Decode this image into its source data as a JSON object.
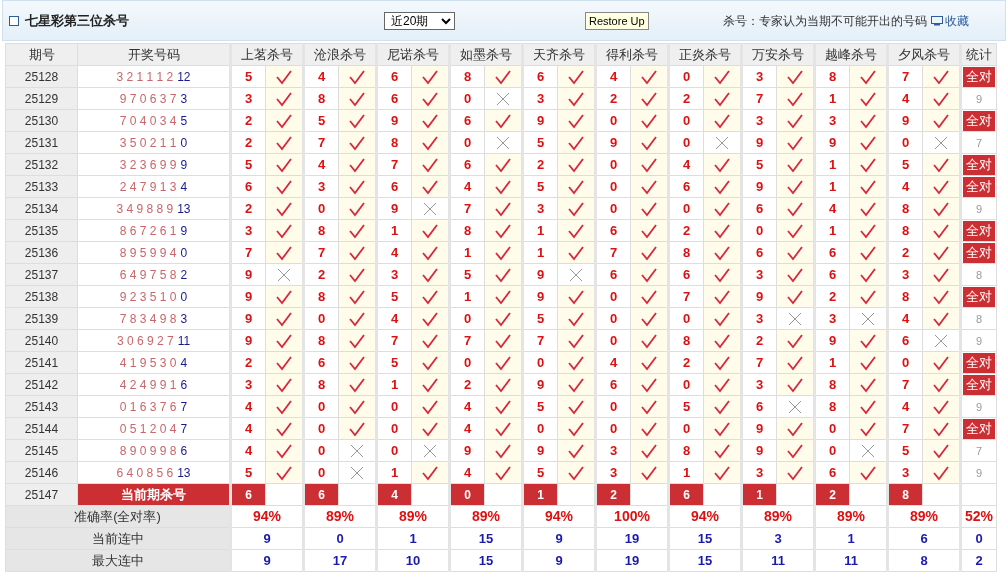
{
  "header": {
    "title": "七星彩第三位杀号",
    "period_select": "近20期",
    "restore_button": "Restore Up",
    "note": "杀号：专家认为当期不可能开出的号码",
    "favorite": "收藏"
  },
  "table": {
    "columns": [
      "期号",
      "开奖号码",
      "上茗杀号",
      "沧浪杀号",
      "尼诺杀号",
      "如墨杀号",
      "天齐杀号",
      "得利杀号",
      "正炎杀号",
      "万安杀号",
      "越峰杀号",
      "夕风杀号",
      "统计"
    ],
    "rows": [
      {
        "period": "25128",
        "front": "3 2 1 1 1 2",
        "back": "12",
        "picks": [
          {
            "number": "5",
            "hit": true
          },
          {
            "number": "4",
            "hit": true
          },
          {
            "number": "6",
            "hit": true
          },
          {
            "number": "8",
            "hit": true
          },
          {
            "number": "6",
            "hit": true
          },
          {
            "number": "4",
            "hit": true
          },
          {
            "number": "0",
            "hit": true
          },
          {
            "number": "3",
            "hit": true
          },
          {
            "number": "8",
            "hit": true
          },
          {
            "number": "7",
            "hit": true
          }
        ],
        "stat": {
          "text": "全对",
          "all_correct": true
        }
      },
      {
        "period": "25129",
        "front": "9 7 0 6 3 7",
        "back": "3",
        "picks": [
          {
            "number": "3",
            "hit": true
          },
          {
            "number": "8",
            "hit": true
          },
          {
            "number": "6",
            "hit": true
          },
          {
            "number": "0",
            "hit": false
          },
          {
            "number": "3",
            "hit": true
          },
          {
            "number": "2",
            "hit": true
          },
          {
            "number": "2",
            "hit": true
          },
          {
            "number": "7",
            "hit": true
          },
          {
            "number": "1",
            "hit": true
          },
          {
            "number": "4",
            "hit": true
          }
        ],
        "stat": {
          "text": "9",
          "all_correct": false
        }
      },
      {
        "period": "25130",
        "front": "7 0 4 0 3 4",
        "back": "5",
        "picks": [
          {
            "number": "2",
            "hit": true
          },
          {
            "number": "5",
            "hit": true
          },
          {
            "number": "9",
            "hit": true
          },
          {
            "number": "6",
            "hit": true
          },
          {
            "number": "9",
            "hit": true
          },
          {
            "number": "0",
            "hit": true
          },
          {
            "number": "0",
            "hit": true
          },
          {
            "number": "3",
            "hit": true
          },
          {
            "number": "3",
            "hit": true
          },
          {
            "number": "9",
            "hit": true
          }
        ],
        "stat": {
          "text": "全对",
          "all_correct": true
        }
      },
      {
        "period": "25131",
        "front": "3 5 0 2 1 1",
        "back": "0",
        "picks": [
          {
            "number": "2",
            "hit": true
          },
          {
            "number": "7",
            "hit": true
          },
          {
            "number": "8",
            "hit": true
          },
          {
            "number": "0",
            "hit": false
          },
          {
            "number": "5",
            "hit": true
          },
          {
            "number": "9",
            "hit": true
          },
          {
            "number": "0",
            "hit": false
          },
          {
            "number": "9",
            "hit": true
          },
          {
            "number": "9",
            "hit": true
          },
          {
            "number": "0",
            "hit": false
          }
        ],
        "stat": {
          "text": "7",
          "all_correct": false
        }
      },
      {
        "period": "25132",
        "front": "3 2 3 6 9 9",
        "back": "9",
        "picks": [
          {
            "number": "5",
            "hit": true
          },
          {
            "number": "4",
            "hit": true
          },
          {
            "number": "7",
            "hit": true
          },
          {
            "number": "6",
            "hit": true
          },
          {
            "number": "2",
            "hit": true
          },
          {
            "number": "0",
            "hit": true
          },
          {
            "number": "4",
            "hit": true
          },
          {
            "number": "5",
            "hit": true
          },
          {
            "number": "1",
            "hit": true
          },
          {
            "number": "5",
            "hit": true
          }
        ],
        "stat": {
          "text": "全对",
          "all_correct": true
        }
      },
      {
        "period": "25133",
        "front": "2 4 7 9 1 3",
        "back": "4",
        "picks": [
          {
            "number": "6",
            "hit": true
          },
          {
            "number": "3",
            "hit": true
          },
          {
            "number": "6",
            "hit": true
          },
          {
            "number": "4",
            "hit": true
          },
          {
            "number": "5",
            "hit": true
          },
          {
            "number": "0",
            "hit": true
          },
          {
            "number": "6",
            "hit": true
          },
          {
            "number": "9",
            "hit": true
          },
          {
            "number": "1",
            "hit": true
          },
          {
            "number": "4",
            "hit": true
          }
        ],
        "stat": {
          "text": "全对",
          "all_correct": true
        }
      },
      {
        "period": "25134",
        "front": "3 4 9 8 8 9",
        "back": "13",
        "picks": [
          {
            "number": "2",
            "hit": true
          },
          {
            "number": "0",
            "hit": true
          },
          {
            "number": "9",
            "hit": false
          },
          {
            "number": "7",
            "hit": true
          },
          {
            "number": "3",
            "hit": true
          },
          {
            "number": "0",
            "hit": true
          },
          {
            "number": "0",
            "hit": true
          },
          {
            "number": "6",
            "hit": true
          },
          {
            "number": "4",
            "hit": true
          },
          {
            "number": "8",
            "hit": true
          }
        ],
        "stat": {
          "text": "9",
          "all_correct": false
        }
      },
      {
        "period": "25135",
        "front": "8 6 7 2 6 1",
        "back": "9",
        "picks": [
          {
            "number": "3",
            "hit": true
          },
          {
            "number": "8",
            "hit": true
          },
          {
            "number": "1",
            "hit": true
          },
          {
            "number": "8",
            "hit": true
          },
          {
            "number": "1",
            "hit": true
          },
          {
            "number": "6",
            "hit": true
          },
          {
            "number": "2",
            "hit": true
          },
          {
            "number": "0",
            "hit": true
          },
          {
            "number": "1",
            "hit": true
          },
          {
            "number": "8",
            "hit": true
          }
        ],
        "stat": {
          "text": "全对",
          "all_correct": true
        }
      },
      {
        "period": "25136",
        "front": "8 9 5 9 9 4",
        "back": "0",
        "picks": [
          {
            "number": "7",
            "hit": true
          },
          {
            "number": "7",
            "hit": true
          },
          {
            "number": "4",
            "hit": true
          },
          {
            "number": "1",
            "hit": true
          },
          {
            "number": "1",
            "hit": true
          },
          {
            "number": "7",
            "hit": true
          },
          {
            "number": "8",
            "hit": true
          },
          {
            "number": "6",
            "hit": true
          },
          {
            "number": "6",
            "hit": true
          },
          {
            "number": "2",
            "hit": true
          }
        ],
        "stat": {
          "text": "全对",
          "all_correct": true
        }
      },
      {
        "period": "25137",
        "front": "6 4 9 7 5 8",
        "back": "2",
        "picks": [
          {
            "number": "9",
            "hit": false
          },
          {
            "number": "2",
            "hit": true
          },
          {
            "number": "3",
            "hit": true
          },
          {
            "number": "5",
            "hit": true
          },
          {
            "number": "9",
            "hit": false
          },
          {
            "number": "6",
            "hit": true
          },
          {
            "number": "6",
            "hit": true
          },
          {
            "number": "3",
            "hit": true
          },
          {
            "number": "6",
            "hit": true
          },
          {
            "number": "3",
            "hit": true
          }
        ],
        "stat": {
          "text": "8",
          "all_correct": false
        }
      },
      {
        "period": "25138",
        "front": "9 2 3 5 1 0",
        "back": "0",
        "picks": [
          {
            "number": "9",
            "hit": true
          },
          {
            "number": "8",
            "hit": true
          },
          {
            "number": "5",
            "hit": true
          },
          {
            "number": "1",
            "hit": true
          },
          {
            "number": "9",
            "hit": true
          },
          {
            "number": "0",
            "hit": true
          },
          {
            "number": "7",
            "hit": true
          },
          {
            "number": "9",
            "hit": true
          },
          {
            "number": "2",
            "hit": true
          },
          {
            "number": "8",
            "hit": true
          }
        ],
        "stat": {
          "text": "全对",
          "all_correct": true
        }
      },
      {
        "period": "25139",
        "front": "7 8 3 4 9 8",
        "back": "3",
        "picks": [
          {
            "number": "9",
            "hit": true
          },
          {
            "number": "0",
            "hit": true
          },
          {
            "number": "4",
            "hit": true
          },
          {
            "number": "0",
            "hit": true
          },
          {
            "number": "5",
            "hit": true
          },
          {
            "number": "0",
            "hit": true
          },
          {
            "number": "0",
            "hit": true
          },
          {
            "number": "3",
            "hit": false
          },
          {
            "number": "3",
            "hit": false
          },
          {
            "number": "4",
            "hit": true
          }
        ],
        "stat": {
          "text": "8",
          "all_correct": false
        }
      },
      {
        "period": "25140",
        "front": "3 0 6 9 2 7",
        "back": "11",
        "picks": [
          {
            "number": "9",
            "hit": true
          },
          {
            "number": "8",
            "hit": true
          },
          {
            "number": "7",
            "hit": true
          },
          {
            "number": "7",
            "hit": true
          },
          {
            "number": "7",
            "hit": true
          },
          {
            "number": "0",
            "hit": true
          },
          {
            "number": "8",
            "hit": true
          },
          {
            "number": "2",
            "hit": true
          },
          {
            "number": "9",
            "hit": true
          },
          {
            "number": "6",
            "hit": false
          }
        ],
        "stat": {
          "text": "9",
          "all_correct": false
        }
      },
      {
        "period": "25141",
        "front": "4 1 9 5 3 0",
        "back": "4",
        "picks": [
          {
            "number": "2",
            "hit": true
          },
          {
            "number": "6",
            "hit": true
          },
          {
            "number": "5",
            "hit": true
          },
          {
            "number": "0",
            "hit": true
          },
          {
            "number": "0",
            "hit": true
          },
          {
            "number": "4",
            "hit": true
          },
          {
            "number": "2",
            "hit": true
          },
          {
            "number": "7",
            "hit": true
          },
          {
            "number": "1",
            "hit": true
          },
          {
            "number": "0",
            "hit": true
          }
        ],
        "stat": {
          "text": "全对",
          "all_correct": true
        }
      },
      {
        "period": "25142",
        "front": "4 2 4 9 9 1",
        "back": "6",
        "picks": [
          {
            "number": "3",
            "hit": true
          },
          {
            "number": "8",
            "hit": true
          },
          {
            "number": "1",
            "hit": true
          },
          {
            "number": "2",
            "hit": true
          },
          {
            "number": "9",
            "hit": true
          },
          {
            "number": "6",
            "hit": true
          },
          {
            "number": "0",
            "hit": true
          },
          {
            "number": "3",
            "hit": true
          },
          {
            "number": "8",
            "hit": true
          },
          {
            "number": "7",
            "hit": true
          }
        ],
        "stat": {
          "text": "全对",
          "all_correct": true
        }
      },
      {
        "period": "25143",
        "front": "0 1 6 3 7 6",
        "back": "7",
        "picks": [
          {
            "number": "4",
            "hit": true
          },
          {
            "number": "0",
            "hit": true
          },
          {
            "number": "0",
            "hit": true
          },
          {
            "number": "4",
            "hit": true
          },
          {
            "number": "5",
            "hit": true
          },
          {
            "number": "0",
            "hit": true
          },
          {
            "number": "5",
            "hit": true
          },
          {
            "number": "6",
            "hit": false
          },
          {
            "number": "8",
            "hit": true
          },
          {
            "number": "4",
            "hit": true
          }
        ],
        "stat": {
          "text": "9",
          "all_correct": false
        }
      },
      {
        "period": "25144",
        "front": "0 5 1 2 0 4",
        "back": "7",
        "picks": [
          {
            "number": "4",
            "hit": true
          },
          {
            "number": "0",
            "hit": true
          },
          {
            "number": "0",
            "hit": true
          },
          {
            "number": "4",
            "hit": true
          },
          {
            "number": "0",
            "hit": true
          },
          {
            "number": "0",
            "hit": true
          },
          {
            "number": "0",
            "hit": true
          },
          {
            "number": "9",
            "hit": true
          },
          {
            "number": "0",
            "hit": true
          },
          {
            "number": "7",
            "hit": true
          }
        ],
        "stat": {
          "text": "全对",
          "all_correct": true
        }
      },
      {
        "period": "25145",
        "front": "8 9 0 9 9 8",
        "back": "6",
        "picks": [
          {
            "number": "4",
            "hit": true
          },
          {
            "number": "0",
            "hit": false
          },
          {
            "number": "0",
            "hit": false
          },
          {
            "number": "9",
            "hit": true
          },
          {
            "number": "9",
            "hit": true
          },
          {
            "number": "3",
            "hit": true
          },
          {
            "number": "8",
            "hit": true
          },
          {
            "number": "9",
            "hit": true
          },
          {
            "number": "0",
            "hit": false
          },
          {
            "number": "5",
            "hit": true
          }
        ],
        "stat": {
          "text": "7",
          "all_correct": false
        }
      },
      {
        "period": "25146",
        "front": "6 4 0 8 5 6",
        "back": "13",
        "picks": [
          {
            "number": "5",
            "hit": true
          },
          {
            "number": "0",
            "hit": false
          },
          {
            "number": "1",
            "hit": true
          },
          {
            "number": "4",
            "hit": true
          },
          {
            "number": "5",
            "hit": true
          },
          {
            "number": "3",
            "hit": true
          },
          {
            "number": "1",
            "hit": true
          },
          {
            "number": "3",
            "hit": true
          },
          {
            "number": "6",
            "hit": true
          },
          {
            "number": "3",
            "hit": true
          }
        ],
        "stat": {
          "text": "9",
          "all_correct": false
        }
      }
    ],
    "current": {
      "period": "25147",
      "label": "当前期杀号",
      "picks": [
        "6",
        "6",
        "4",
        "0",
        "1",
        "2",
        "6",
        "1",
        "2",
        "8"
      ]
    },
    "summary": [
      {
        "label": "准确率(全对率)",
        "kind": "rate",
        "values": [
          "94%",
          "89%",
          "89%",
          "89%",
          "94%",
          "100%",
          "94%",
          "89%",
          "89%",
          "89%",
          "52%"
        ]
      },
      {
        "label": "当前连中",
        "kind": "count",
        "values": [
          "9",
          "0",
          "1",
          "15",
          "9",
          "19",
          "15",
          "3",
          "1",
          "6",
          "0"
        ]
      },
      {
        "label": "最大连中",
        "kind": "count",
        "values": [
          "9",
          "17",
          "10",
          "15",
          "9",
          "19",
          "15",
          "11",
          "11",
          "8",
          "2"
        ]
      }
    ]
  }
}
